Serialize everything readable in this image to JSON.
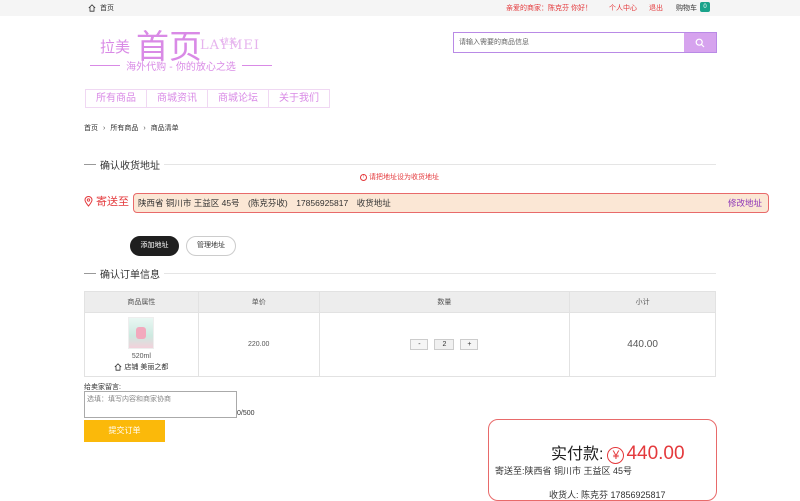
{
  "topbar": {
    "home_label": "首页",
    "greeting": "亲爱的商家：陈克芬 你好！",
    "user_center": "个人中心",
    "logout": "退出",
    "cart_label": "购物车",
    "cart_count": "0"
  },
  "logo": {
    "small": "拉美",
    "big": "首页",
    "latin": "LAYMEI",
    "latin_overlay": "拉美",
    "slogan": "海外代购 - 你的放心之选"
  },
  "search": {
    "placeholder": "请输入需要的商品信息"
  },
  "nav": [
    "所有商品",
    "商城资讯",
    "商城论坛",
    "关于我们"
  ],
  "breadcrumb": [
    "首页",
    "所有商品",
    "商品清单"
  ],
  "address_section": {
    "title": "确认收货地址",
    "warning": "请把地址设为收货地址",
    "ship_to_label": "寄送至",
    "address_text": "陕西省 铜川市 王益区 45号　(陈克芬收)　17856925817　收货地址",
    "edit_label": "修改地址",
    "add_button": "添加地址",
    "manage_button": "管理地址"
  },
  "order_section": {
    "title": "确认订单信息",
    "columns": [
      "商品属性",
      "单价",
      "数量",
      "小计"
    ],
    "rows": [
      {
        "spec": "520ml",
        "shop": "店铺 美丽之都",
        "unit_price": "220.00",
        "quantity": "2",
        "subtotal": "440.00"
      }
    ]
  },
  "message": {
    "label": "给卖家留言:",
    "placeholder": "选填：填写内容和商家协商",
    "counter": "0/500"
  },
  "submit_label": "提交订单",
  "summary": {
    "pay_label": "实付款:",
    "currency_symbol": "¥",
    "amount": "440.00",
    "ship_to": "寄送至:陕西省 铜川市 王益区 45号",
    "receiver": "收货人:  陈克芬 17856925817"
  },
  "colors": {
    "accent_red": "#e4393c",
    "brand_purple": "#d98ae6",
    "submit_yellow": "#fbb90a",
    "address_bg": "#fbe7d5"
  }
}
